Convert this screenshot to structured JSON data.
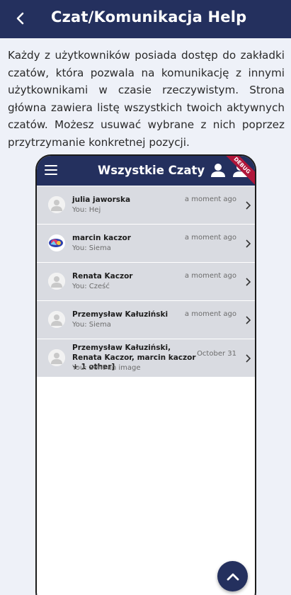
{
  "header": {
    "title": "Czat/Komunikacja Help",
    "back_icon": "arrow-back-icon"
  },
  "description": "Każdy z użytkowników posiada dostęp do zakładki czatów, która pozwala na komunikację z innymi użytkownikami w czasie rzeczywistym. Strona główna zawiera listę wszystkich twoich aktywnych czatów. Możesz usuwać wybrane z nich poprzez przytrzymanie konkretnej pozycji.",
  "phone": {
    "title": "Wszystkie Czaty",
    "debug_banner": "DEBUG",
    "chats": [
      {
        "name": "julia jaworska",
        "message": "You: Hej",
        "time": "a moment ago"
      },
      {
        "name": "marcin kaczor",
        "message": "You: Siema",
        "time": "a moment ago"
      },
      {
        "name": "Renata Kaczor",
        "message": "You: Cześć",
        "time": "a moment ago"
      },
      {
        "name": "Przemysław Kałuziński",
        "message": "You: Siema",
        "time": "a moment ago"
      },
      {
        "name": "Przemysław Kałuziński, Renata Kaczor, marcin kaczor + 1 other]",
        "message": "You: Sent an image",
        "time": "October 31"
      }
    ]
  },
  "colors": {
    "primary": "#24305e",
    "background": "#eef1f8",
    "list_item": "#d9dbe1",
    "debug": "#b0163a"
  },
  "fab": {
    "icon": "chevron-up-icon"
  }
}
